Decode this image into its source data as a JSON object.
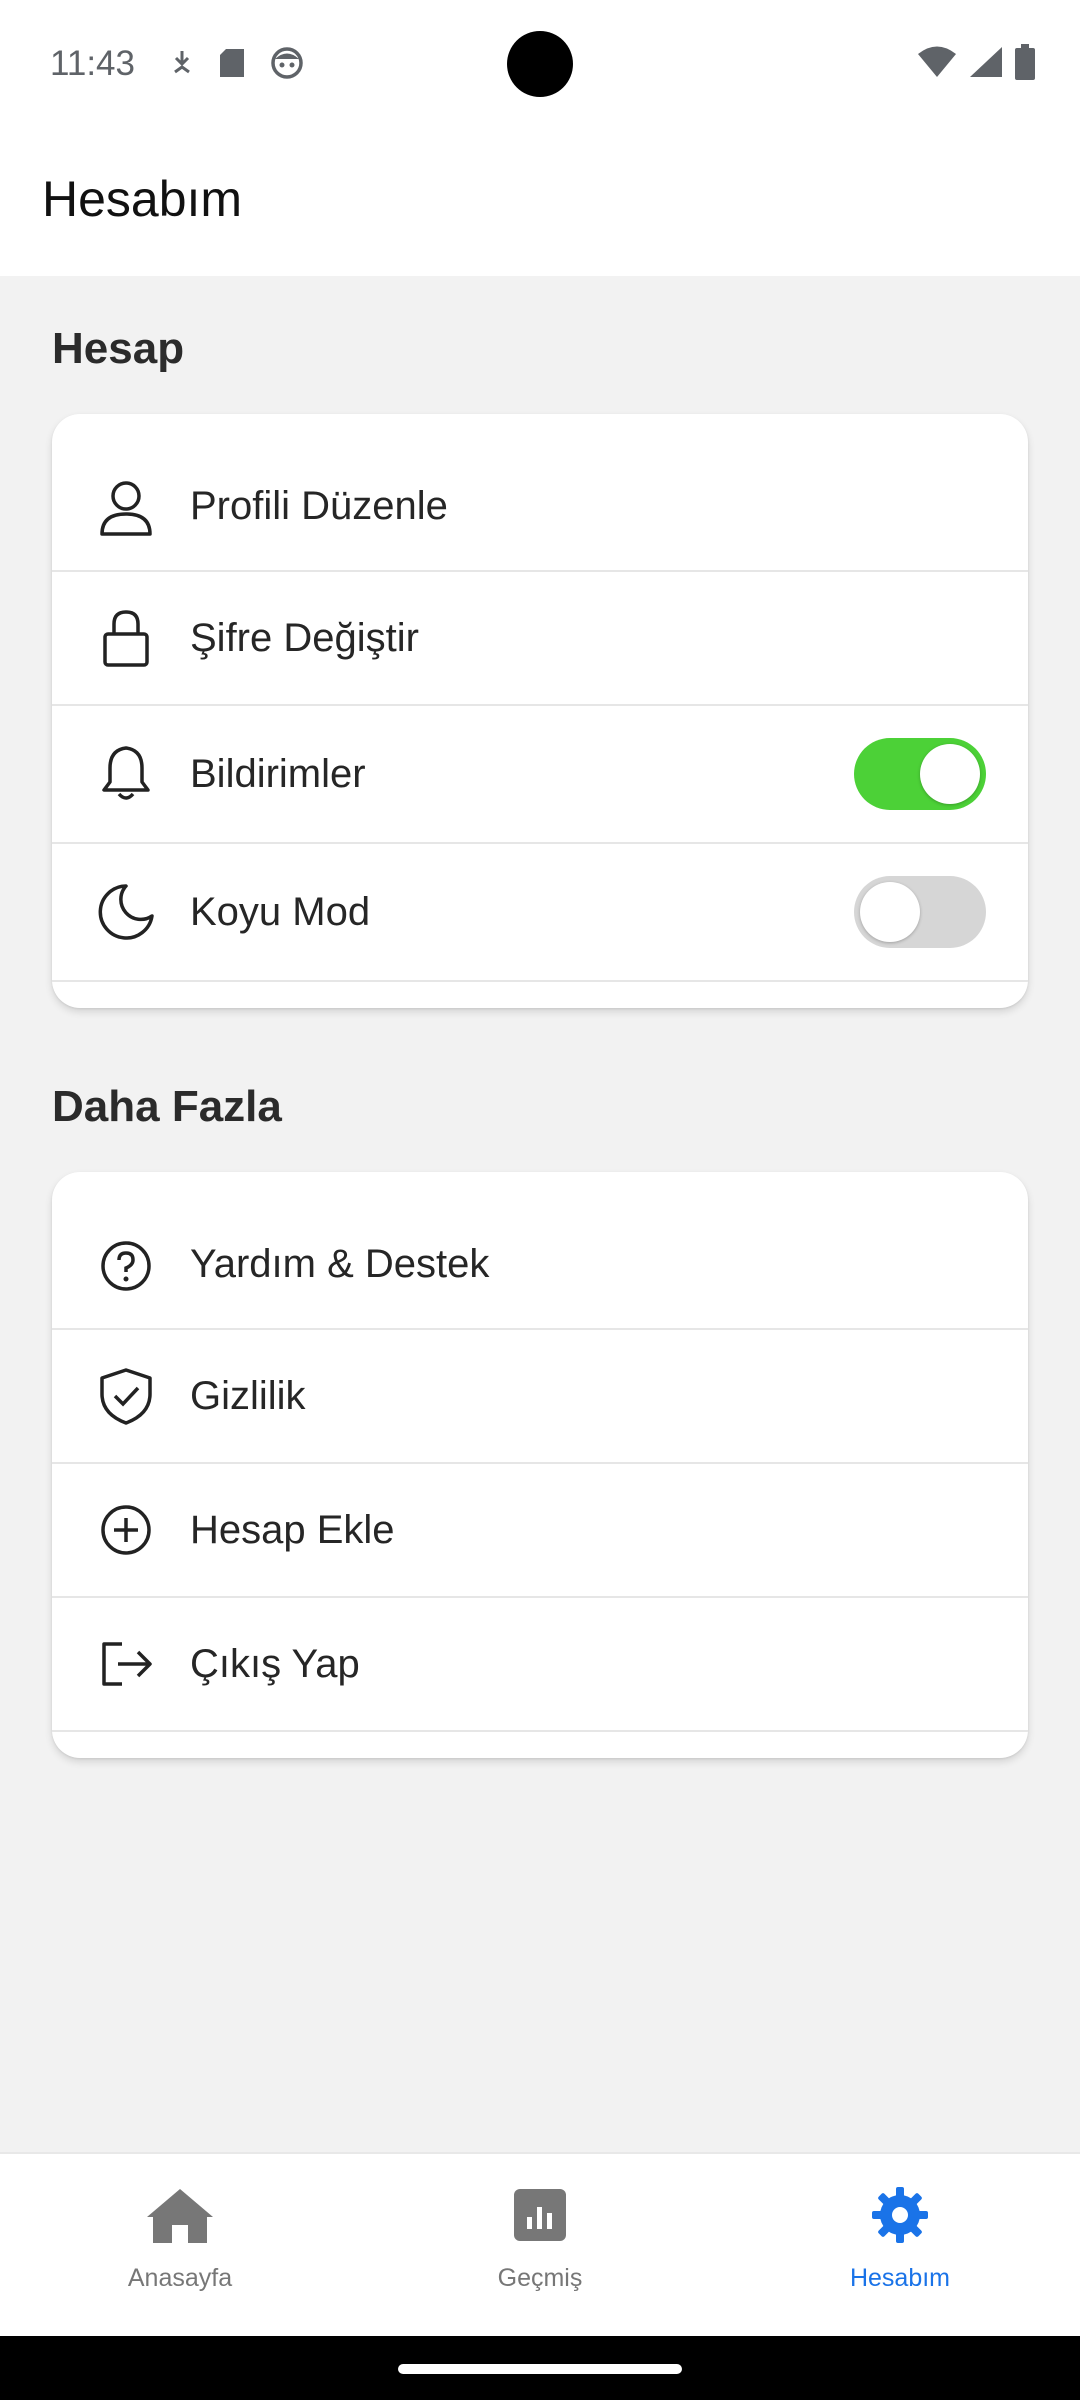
{
  "status_bar": {
    "time": "11:43"
  },
  "app_bar": {
    "title": "Hesabım"
  },
  "sections": {
    "account": {
      "title": "Hesap",
      "items": [
        {
          "label": "Profili Düzenle",
          "icon": "person-icon"
        },
        {
          "label": "Şifre Değiştir",
          "icon": "lock-icon"
        },
        {
          "label": "Bildirimler",
          "icon": "bell-icon",
          "toggle": true
        },
        {
          "label": "Koyu Mod",
          "icon": "moon-icon",
          "toggle": false
        }
      ]
    },
    "more": {
      "title": "Daha Fazla",
      "items": [
        {
          "label": "Yardım & Destek",
          "icon": "help-circle-icon"
        },
        {
          "label": "Gizlilik",
          "icon": "shield-check-icon"
        },
        {
          "label": "Hesap Ekle",
          "icon": "plus-circle-icon"
        },
        {
          "label": "Çıkış Yap",
          "icon": "logout-icon"
        }
      ]
    }
  },
  "bottom_nav": {
    "items": [
      {
        "label": "Anasayfa",
        "icon": "home-icon",
        "active": false
      },
      {
        "label": "Geçmiş",
        "icon": "chart-icon",
        "active": false
      },
      {
        "label": "Hesabım",
        "icon": "gear-icon",
        "active": true
      }
    ]
  },
  "colors": {
    "accent": "#1a73e8",
    "toggle_on": "#4cd137",
    "toggle_off": "#d6d6d6"
  }
}
